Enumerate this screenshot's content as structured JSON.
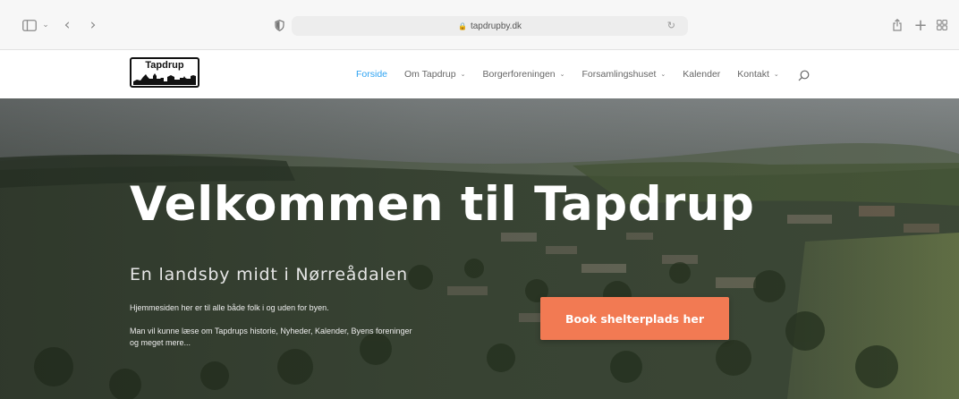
{
  "browser": {
    "url": "tapdrupby.dk",
    "icons": {
      "sidebar": "sidebar-icon",
      "tab_overview": "chevron-down-icon",
      "back": "back-icon",
      "forward": "forward-icon",
      "privacy": "shield-icon",
      "lock": "lock-icon",
      "reload": "reload-icon",
      "share": "share-icon",
      "new_tab": "plus-icon",
      "tabs": "tabs-grid-icon"
    },
    "glyphs": {
      "back": "‹",
      "forward": "›",
      "chevron": "⌄",
      "reload": "↻",
      "plus": "+",
      "lock": "🔒"
    }
  },
  "site": {
    "logo_text": "Tapdrup",
    "nav": [
      {
        "label": "Forside",
        "active": true,
        "dropdown": false
      },
      {
        "label": "Om Tapdrup",
        "active": false,
        "dropdown": true
      },
      {
        "label": "Borgerforeningen",
        "active": false,
        "dropdown": true
      },
      {
        "label": "Forsamlingshuset",
        "active": false,
        "dropdown": true
      },
      {
        "label": "Kalender",
        "active": false,
        "dropdown": false
      },
      {
        "label": "Kontakt",
        "active": false,
        "dropdown": true
      }
    ],
    "caret": "⌄",
    "accent_color": "#2ea3f2",
    "nav_text_color": "#666666"
  },
  "hero": {
    "title": "Velkommen til Tapdrup",
    "subtitle": "En landsby midt i Nørreådalen",
    "paragraph_1": "Hjemmesiden her er til alle både folk i og uden for byen.",
    "paragraph_2": "Man vil kunne læse om Tapdrups historie, Nyheder, Kalender, Byens foreninger og meget mere...",
    "cta_label": "Book shelterplads her",
    "cta_color": "#f27a53"
  }
}
